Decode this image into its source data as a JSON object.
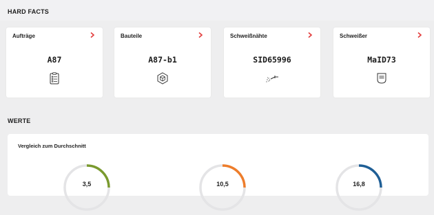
{
  "hard_facts": {
    "title": "HARD FACTS",
    "cards": [
      {
        "title": "Aufträge",
        "value": "A87",
        "icon": "clipboard-list-icon"
      },
      {
        "title": "Bauteile",
        "value": "A87-b1",
        "icon": "cube-icon"
      },
      {
        "title": "Schweißnähte",
        "value": "SID65996",
        "icon": "welding-torch-icon"
      },
      {
        "title": "Schweißer",
        "value": "MaID73",
        "icon": "id-badge-icon"
      }
    ]
  },
  "werte": {
    "title": "WERTE",
    "panel_title": "Vergleich zum Durchschnitt",
    "gauges": [
      {
        "value": "3,5",
        "color": "#7a9a2e"
      },
      {
        "value": "10,5",
        "color": "#ee7d2b"
      },
      {
        "value": "16,8",
        "color": "#1f5f96"
      }
    ]
  },
  "colors": {
    "chevron": "#e23b3b",
    "track": "#e4e4e6"
  }
}
